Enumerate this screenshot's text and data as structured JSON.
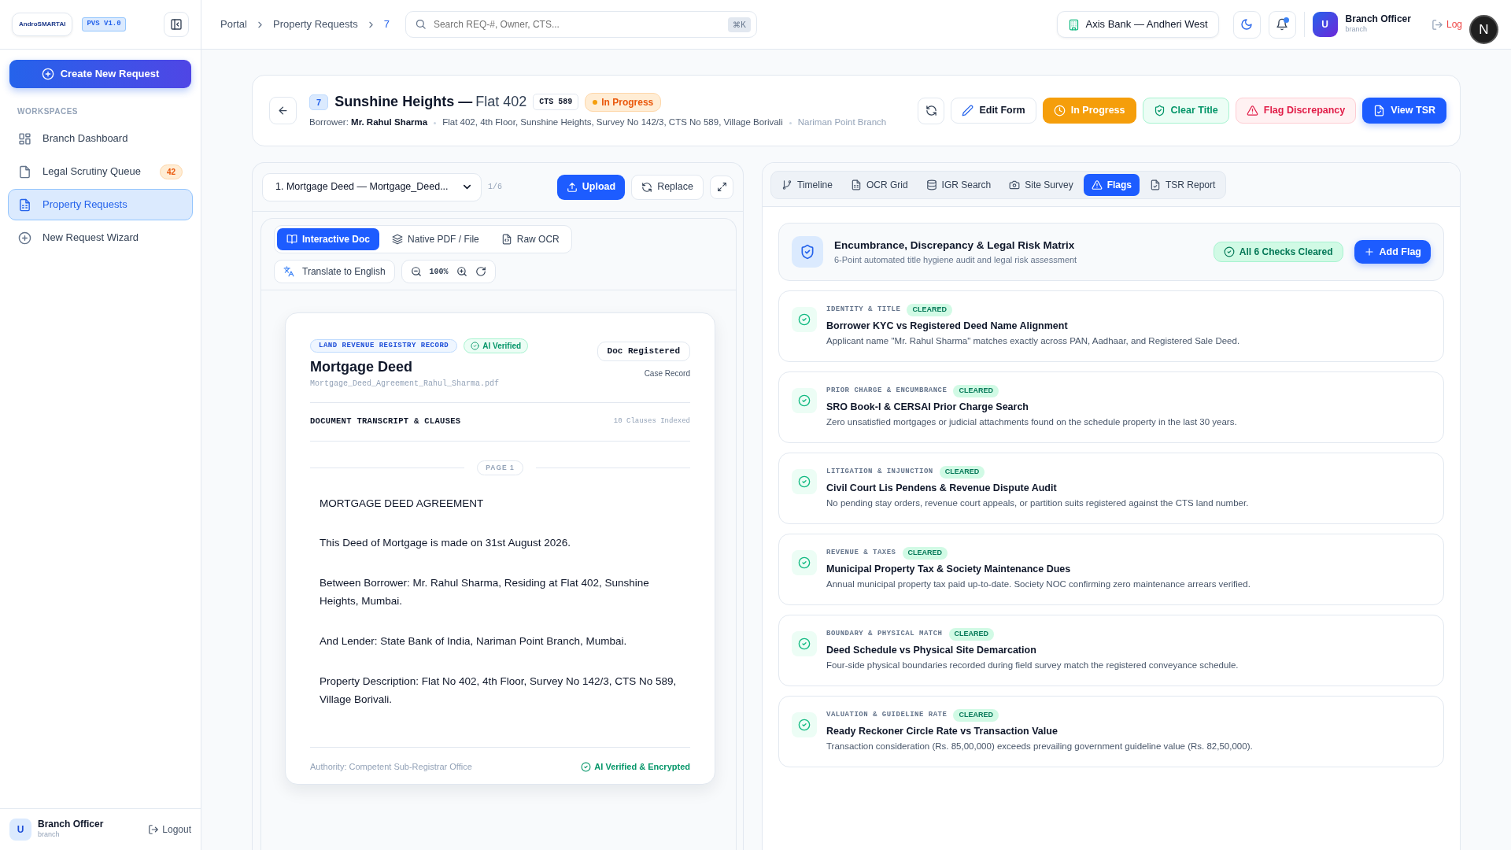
{
  "sidebar": {
    "logo": "AndroSMARTAI",
    "version": "PVS V1.0",
    "create_button": "Create New Request",
    "section": "WORKSPACES",
    "items": [
      {
        "label": "Branch Dashboard",
        "selected": false
      },
      {
        "label": "Legal Scrutiny Queue",
        "badge": "42",
        "selected": false
      },
      {
        "label": "Property Requests",
        "selected": true
      },
      {
        "label": "New Request Wizard",
        "selected": false
      }
    ],
    "user": {
      "initial": "U",
      "name": "Branch Officer",
      "role": "branch"
    },
    "logout": "Logout"
  },
  "topbar": {
    "breadcrumbs": [
      "Portal",
      "Property Requests",
      "7"
    ],
    "search": {
      "placeholder": "Search REQ-#, Owner, CTS...",
      "shortcut": "⌘K"
    },
    "branch": "Axis Bank — Andheri West",
    "unread": true,
    "user": {
      "initial": "U",
      "name": "Branch Officer",
      "role": "branch"
    },
    "logout": "Log",
    "overlay_badge": "N"
  },
  "header": {
    "id": "7",
    "title": "Sunshine Heights —",
    "subtitle": "Flat 402",
    "cts": "CTS 589",
    "status": "In Progress",
    "borrower_label": "Borrower:",
    "borrower": "Mr. Rahul Sharma",
    "address": "Flat 402, 4th Floor, Sunshine Heights, Survey No 142/3, CTS No 589, Village Borivali",
    "branch": "Nariman Point Branch",
    "actions": [
      {
        "label": "Edit Form",
        "kind": "outline"
      },
      {
        "label": "In Progress",
        "kind": "warning"
      },
      {
        "label": "Clear Title",
        "kind": "success"
      },
      {
        "label": "Flag Discrepancy",
        "kind": "danger"
      },
      {
        "label": "View TSR",
        "kind": "primary"
      }
    ]
  },
  "document_pane": {
    "selector": "1. Mortgage Deed — Mortgage_Deed...",
    "counter": "1/6",
    "upload": "Upload",
    "replace": "Replace",
    "view_tabs": [
      {
        "label": "Interactive Doc",
        "selected": true
      },
      {
        "label": "Native PDF / File",
        "selected": false
      },
      {
        "label": "Raw OCR",
        "selected": false
      }
    ],
    "translate": "Translate to English",
    "zoom": "100%",
    "document": {
      "tag": "LAND REVENUE REGISTRY RECORD",
      "verified": "AI Verified",
      "title": "Mortgage Deed",
      "file": "Mortgage_Deed_Agreement_Rahul_Sharma.pdf",
      "registered": "Doc Registered",
      "record": "Case Record",
      "section": "DOCUMENT TRANSCRIPT & CLAUSES",
      "clauses": "10 Clauses Indexed",
      "page": "PAGE 1",
      "paragraphs": [
        "MORTGAGE DEED AGREEMENT",
        "This Deed of Mortgage is made on 31st August 2026.",
        "Between Borrower: Mr. Rahul Sharma, Residing at Flat 402, Sunshine Heights, Mumbai.",
        "And Lender: State Bank of India, Nariman Point Branch, Mumbai.",
        "Property Description: Flat No 402, 4th Floor, Survey No 142/3, CTS No 589, Village Borivali."
      ],
      "authority": "Authority: Competent Sub-Registrar Office",
      "footer_badge": "AI Verified & Encrypted"
    }
  },
  "analysis_pane": {
    "tabs": [
      {
        "label": "Timeline",
        "selected": false
      },
      {
        "label": "OCR Grid",
        "selected": false
      },
      {
        "label": "IGR Search",
        "selected": false
      },
      {
        "label": "Site Survey",
        "selected": false
      },
      {
        "label": "Flags",
        "selected": true
      },
      {
        "label": "TSR Report",
        "selected": false
      }
    ],
    "matrix": {
      "title": "Encumbrance, Discrepancy & Legal Risk Matrix",
      "subtitle": "6-Point automated title hygiene audit and legal risk assessment",
      "summary": "All 6 Checks Cleared",
      "add_button": "Add Flag"
    },
    "checks": [
      {
        "category": "IDENTITY & TITLE",
        "status": "CLEARED",
        "title": "Borrower KYC vs Registered Deed Name Alignment",
        "detail": "Applicant name \"Mr. Rahul Sharma\" matches exactly across PAN, Aadhaar, and Registered Sale Deed."
      },
      {
        "category": "PRIOR CHARGE & ENCUMBRANCE",
        "status": "CLEARED",
        "title": "SRO Book-I & CERSAI Prior Charge Search",
        "detail": "Zero unsatisfied mortgages or judicial attachments found on the schedule property in the last 30 years."
      },
      {
        "category": "LITIGATION & INJUNCTION",
        "status": "CLEARED",
        "title": "Civil Court Lis Pendens & Revenue Dispute Audit",
        "detail": "No pending stay orders, revenue court appeals, or partition suits registered against the CTS land number."
      },
      {
        "category": "REVENUE & TAXES",
        "status": "CLEARED",
        "title": "Municipal Property Tax & Society Maintenance Dues",
        "detail": "Annual municipal property tax paid up-to-date. Society NOC confirming zero maintenance arrears verified."
      },
      {
        "category": "BOUNDARY & PHYSICAL MATCH",
        "status": "CLEARED",
        "title": "Deed Schedule vs Physical Site Demarcation",
        "detail": "Four-side physical boundaries recorded during field survey match the registered conveyance schedule."
      },
      {
        "category": "VALUATION & GUIDELINE RATE",
        "status": "CLEARED",
        "title": "Ready Reckoner Circle Rate vs Transaction Value",
        "detail": "Transaction consideration (Rs. 85,00,000) exceeds prevailing government guideline value (Rs. 82,50,000)."
      }
    ]
  }
}
